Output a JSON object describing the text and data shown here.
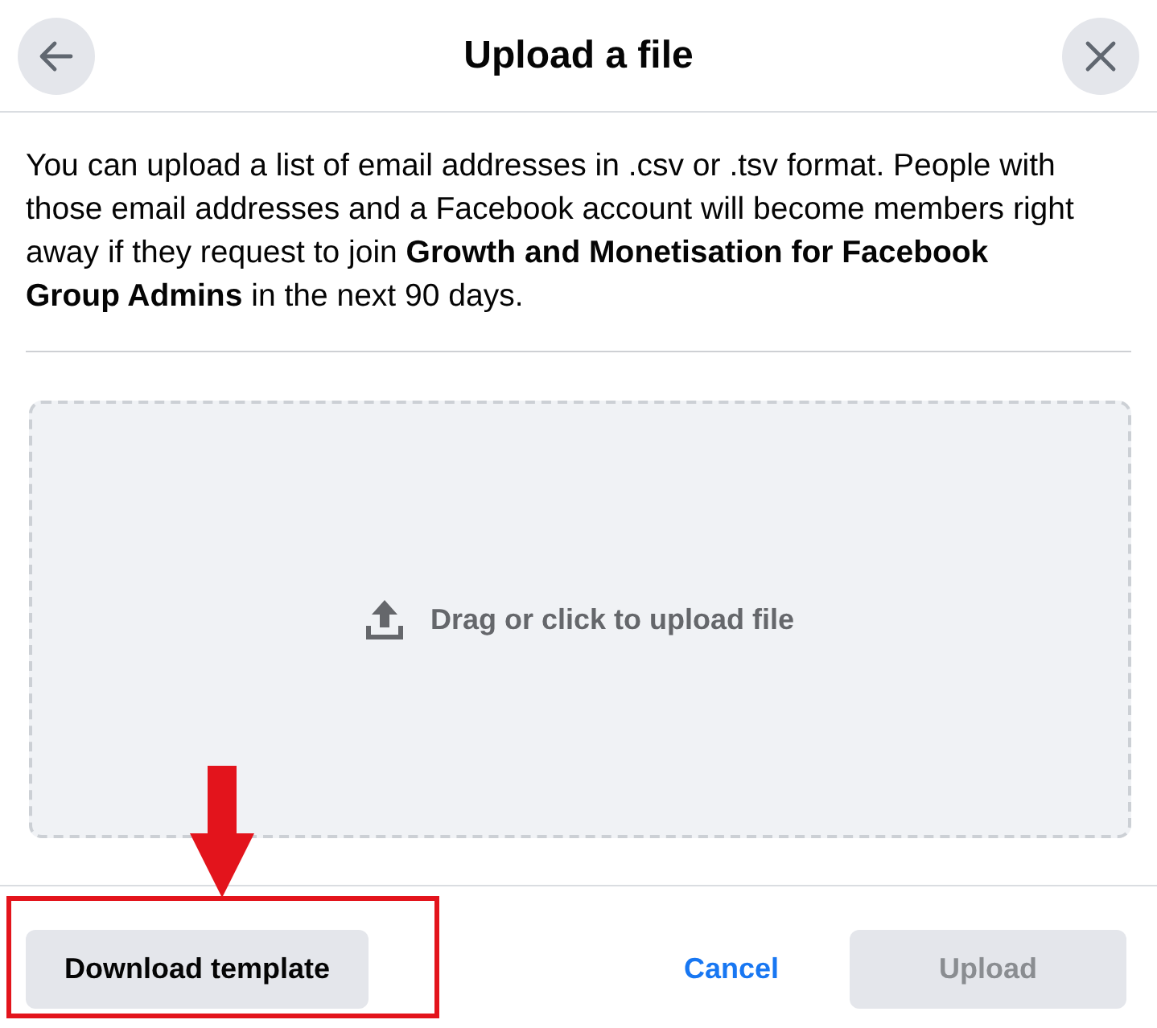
{
  "header": {
    "title": "Upload a file"
  },
  "description": "You can upload a list of email addresses in .csv or .tsv format. People with those email addresses and a Facebook account will become members right away if they request to join **Growth and Monetisation for Facebook Group Admins** in the next 90 days.",
  "dropzone": {
    "label": "Drag or click to upload file"
  },
  "footer": {
    "buttons": [
      {
        "kind": "secondary",
        "label": "Download template",
        "disabled": false
      },
      {
        "kind": "link",
        "label": "Cancel",
        "disabled": false
      },
      {
        "kind": "primary",
        "label": "Upload",
        "disabled": true
      }
    ]
  },
  "annotation": {
    "kind": "arrow-frame"
  }
}
